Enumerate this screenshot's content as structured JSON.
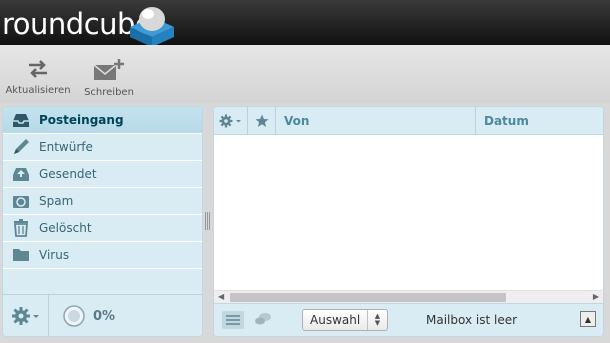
{
  "header": {
    "logo_text": "roundcube"
  },
  "toolbar": {
    "refresh_label": "Aktualisieren",
    "compose_label": "Schreiben"
  },
  "folders": [
    {
      "label": "Posteingang",
      "icon": "inbox-icon",
      "selected": true
    },
    {
      "label": "Entwürfe",
      "icon": "pencil-icon",
      "selected": false
    },
    {
      "label": "Gesendet",
      "icon": "sent-icon",
      "selected": false
    },
    {
      "label": "Spam",
      "icon": "recycle-icon",
      "selected": false
    },
    {
      "label": "Gelöscht",
      "icon": "trash-icon",
      "selected": false
    },
    {
      "label": "Virus",
      "icon": "folder-icon",
      "selected": false
    }
  ],
  "quota": {
    "percent": "0%"
  },
  "message_list": {
    "columns": {
      "from": "Von",
      "date": "Datum"
    },
    "select_value": "Auswahl",
    "status": "Mailbox ist leer"
  },
  "colors": {
    "accent": "#4a8aa0",
    "panel": "#d9ecf4",
    "header": "#1e1e1e"
  }
}
